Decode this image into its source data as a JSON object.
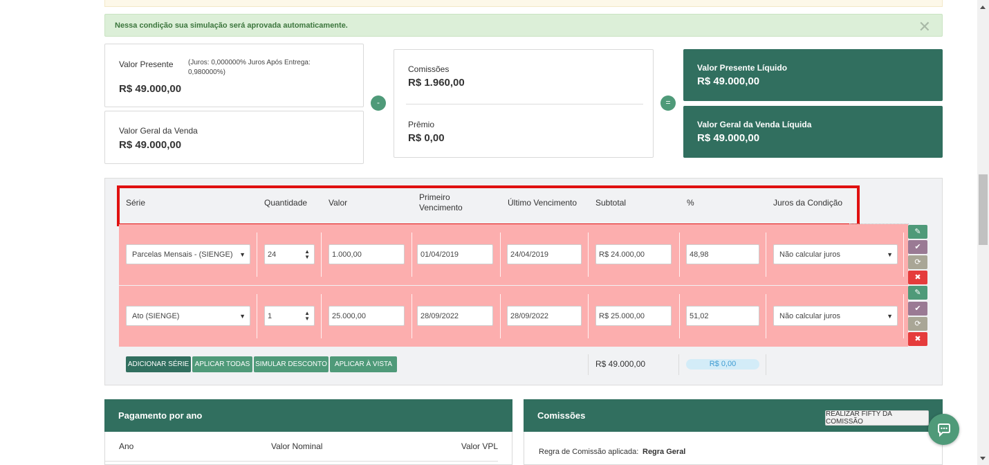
{
  "alert": {
    "text": "Nessa condição sua simulação será aprovada automaticamente.",
    "close": "✕"
  },
  "summary": {
    "valor_presente": {
      "label": "Valor Presente",
      "note": "(Juros: 0,000000%   Juros Após Entrega: 0,980000%)",
      "value": "R$ 49.000,00"
    },
    "valor_geral": {
      "label": "Valor Geral da Venda",
      "value": "R$ 49.000,00"
    },
    "minus_op": "-",
    "equals_op": "=",
    "comissoes": {
      "label": "Comissões",
      "value": "R$ 1.960,00"
    },
    "premio": {
      "label": "Prêmio",
      "value": "R$ 0,00"
    },
    "vp_liquido": {
      "label": "Valor Presente Líquido",
      "value": "R$ 49.000,00"
    },
    "vg_liquida": {
      "label": "Valor Geral da Venda Líquida",
      "value": "R$ 49.000,00"
    }
  },
  "table": {
    "headers": [
      "Série",
      "Quantidade",
      "Valor",
      "Primeiro Vencimento",
      "Último Vencimento",
      "Subtotal",
      "%",
      "Juros da Condição"
    ],
    "rows": [
      {
        "serie": "Parcelas Mensais - (SIENGE)",
        "quantidade": "24",
        "valor": "1.000,00",
        "primeiro": "01/04/2019",
        "ultimo": "24/04/2019",
        "subtotal": "R$ 24.000,00",
        "percent": "48,98",
        "juros": "Não calcular juros"
      },
      {
        "serie": "Ato (SIENGE)",
        "quantidade": "1",
        "valor": "25.000,00",
        "primeiro": "28/09/2022",
        "ultimo": "28/09/2022",
        "subtotal": "R$ 25.000,00",
        "percent": "51,02",
        "juros": "Não calcular juros"
      }
    ],
    "actions": {
      "edit_icon": "✎",
      "check_icon": "✔",
      "refresh_icon": "⟳",
      "delete_icon": "✖"
    },
    "buttons": {
      "add": "ADICIONAR SÉRIE",
      "apply_all": "APLICAR TODAS",
      "simulate": "SIMULAR DESCONTO",
      "apply_cash": "APLICAR À VISTA"
    },
    "total": "R$ 49.000,00",
    "discount": "R$ 0,00"
  },
  "pagamento": {
    "title": "Pagamento por ano",
    "col_ano": "Ano",
    "col_nominal": "Valor Nominal",
    "col_vpl": "Valor VPL"
  },
  "comissoes_panel": {
    "title": "Comissões",
    "button": "REALIZAR FIFTY DA COMISSÃO",
    "rule_label": "Regra de Comissão aplicada:",
    "rule_value": "Regra Geral"
  },
  "colors": {
    "accent": "#316f5f",
    "green": "#4f9a79",
    "row_bg": "#fcaeae",
    "alert_bg": "#dcefd8",
    "highlight": "#e01010"
  }
}
